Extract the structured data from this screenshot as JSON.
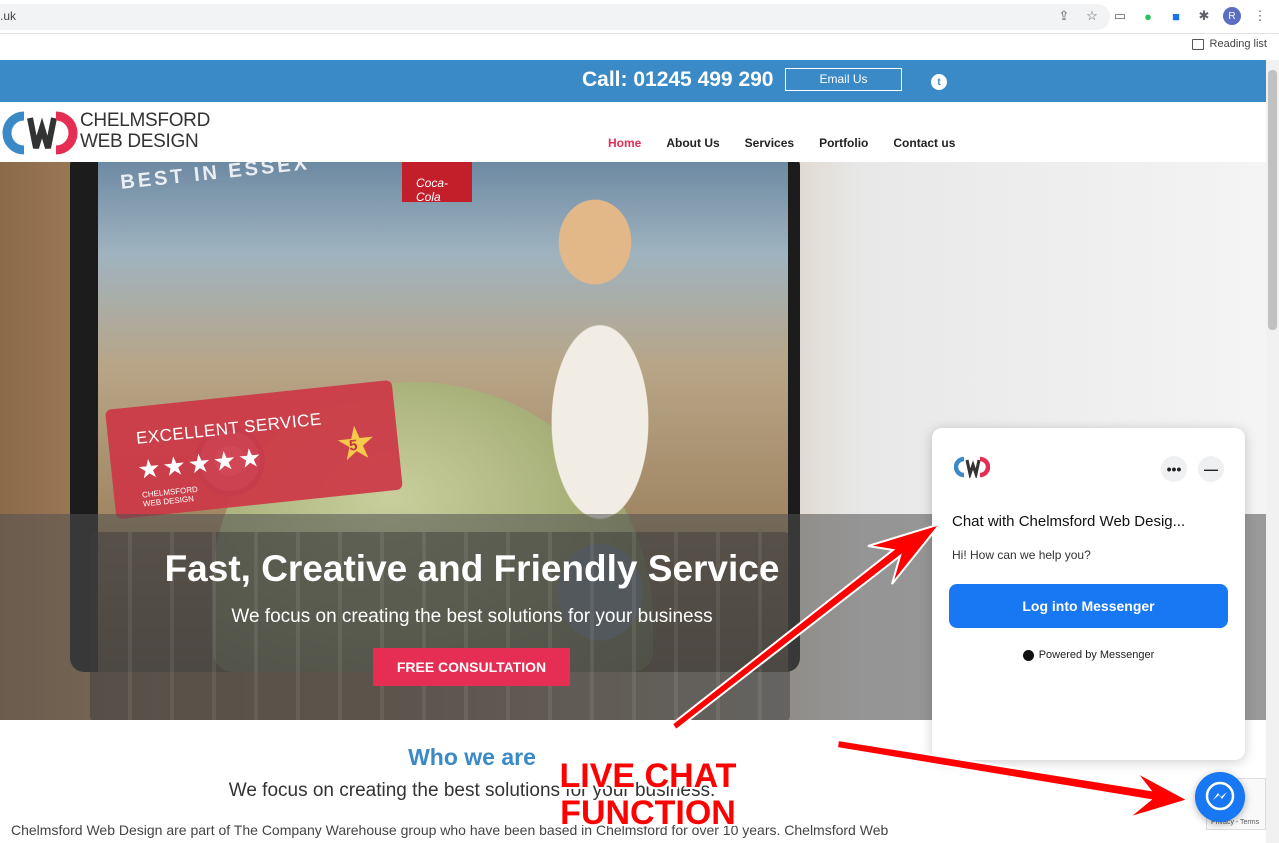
{
  "browser": {
    "url_fragment": ".uk",
    "reading_list": "Reading list",
    "profile_initial": "R"
  },
  "topbar": {
    "call": "Call: 01245 499 290",
    "email_button": "Email Us"
  },
  "brand": {
    "line1": "CHELMSFORD",
    "line2": "WEB DESIGN",
    "colors": {
      "blue": "#3a8ac8",
      "red": "#e62d54",
      "messenger": "#1877f2"
    }
  },
  "nav": {
    "items": [
      "Home",
      "About Us",
      "Services",
      "Portfolio",
      "Contact us"
    ],
    "active": "Home"
  },
  "hero": {
    "image_text_best": "BEST IN ESSEX",
    "card_title": "EXCELLENT SERVICE",
    "card_stars": "★★★★★",
    "card_badge": "5",
    "card_brand_1": "CHELMSFORD",
    "card_brand_2": "WEB DESIGN",
    "cola": "Coca-Cola",
    "title": "Fast, Creative and Friendly Service",
    "subtitle": "We focus on creating the best solutions for your business",
    "cta": "FREE CONSULTATION"
  },
  "who": {
    "title": "Who we are",
    "subtitle": "We focus on creating the best solutions for your business.",
    "paragraph": "Chelmsford Web Design are part of The Company Warehouse group who have been based in Chelmsford for over 10 years. Chelmsford Web"
  },
  "chat": {
    "title": "Chat with Chelmsford Web Desig...",
    "greeting": "Hi! How can we help you?",
    "login_button": "Log into Messenger",
    "powered": "Powered by Messenger",
    "dots": "•••",
    "minimize": "—"
  },
  "recaptcha": {
    "label": "Privacy - Terms"
  },
  "annotation": {
    "line1": "LIVE CHAT",
    "line2": "FUNCTION",
    "color": "#ff0000"
  }
}
